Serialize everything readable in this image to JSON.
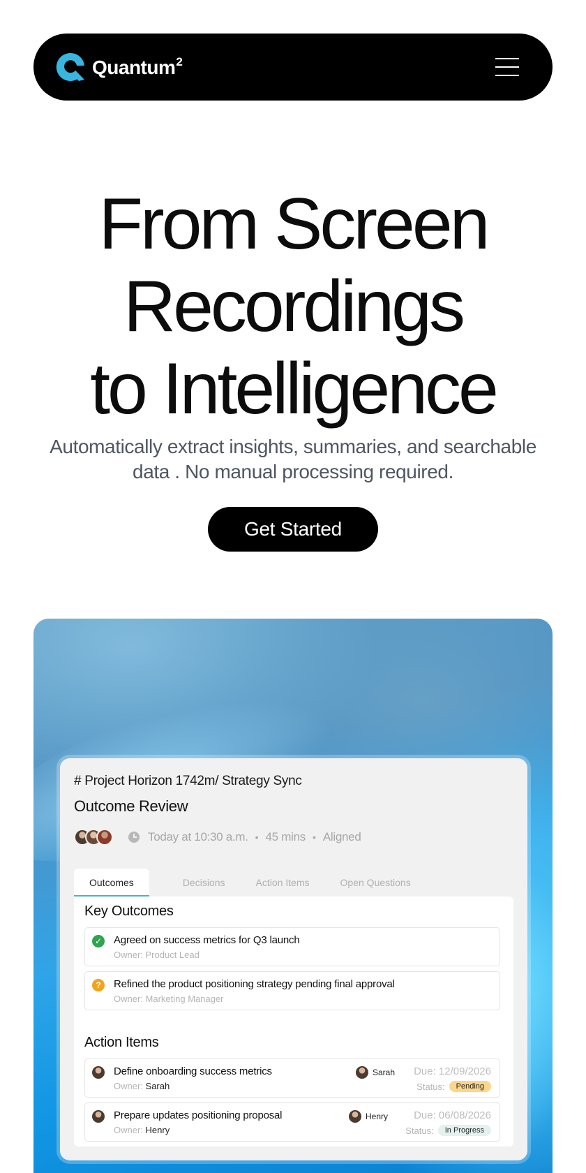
{
  "nav": {
    "brand": "Quantum",
    "brand_sup": "2",
    "menu_icon": "hamburger-menu-icon"
  },
  "hero": {
    "title_lines": [
      "From Screen",
      "Recordings",
      "to Intelligence"
    ],
    "subtitle": "Automatically extract insights, summaries, and searchable data . No manual processing required.",
    "cta_label": "Get Started"
  },
  "card": {
    "breadcrumb": "# Project Horizon 1742m/ Strategy Sync",
    "title": "Outcome Review",
    "meta": {
      "time": "Today at 10:30 a.m.",
      "duration": "45 mins",
      "status": "Aligned"
    },
    "tabs": [
      {
        "label": "Outcomes",
        "active": true
      },
      {
        "label": "Decisions",
        "active": false
      },
      {
        "label": "Action Items",
        "active": false
      },
      {
        "label": "Open Questions",
        "active": false
      }
    ],
    "key_outcomes": {
      "title": "Key Outcomes",
      "items": [
        {
          "text": "Agreed on success metrics for Q3 launch",
          "owner": "Owner: Product Lead",
          "icon": "check-icon",
          "icon_color": "#2ea44f"
        },
        {
          "text": "Refined the product positioning strategy pending final approval",
          "owner": "Owner: Marketing Manager",
          "icon": "question-icon",
          "icon_color": "#f3a21b"
        }
      ]
    },
    "action_items": {
      "title": "Action Items",
      "items": [
        {
          "text": "Define onboarding success metrics",
          "owner_label": "Owner:",
          "owner": "Sarah",
          "assignee": "Sarah",
          "due": "Due: 12/09/2026",
          "status_label": "Status:",
          "status": "Pending",
          "status_color": "#fcd68a"
        },
        {
          "text": "Prepare updates positioning proposal",
          "owner_label": "Owner:",
          "owner": "Henry",
          "assignee": "Henry",
          "due": "Due: 06/08/2026",
          "status_label": "Status:",
          "status": "In Progress",
          "status_color": "#e4f1ee"
        }
      ]
    }
  },
  "colors": {
    "accent": "#3fb6c9",
    "brand": "#38b6e0"
  }
}
